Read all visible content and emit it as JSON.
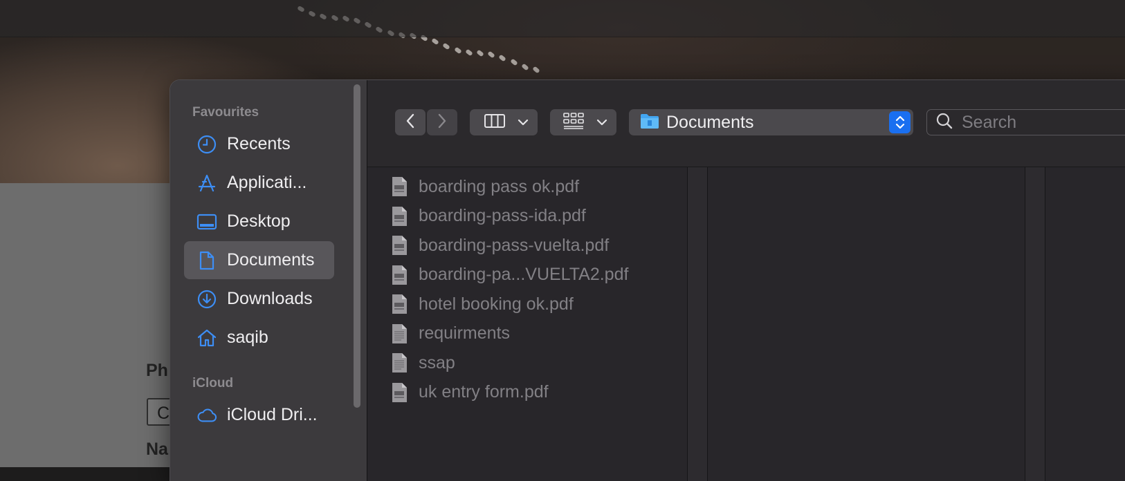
{
  "background": {
    "field_labels": [
      "Ph",
      "Na"
    ],
    "field_value": "C"
  },
  "sidebar": {
    "sections": [
      {
        "title": "Favourites",
        "items": [
          {
            "label": "Recents",
            "icon": "clock-icon",
            "selected": false
          },
          {
            "label": "Applicati...",
            "icon": "applications-icon",
            "selected": false
          },
          {
            "label": "Desktop",
            "icon": "desktop-icon",
            "selected": false
          },
          {
            "label": "Documents",
            "icon": "document-icon",
            "selected": true
          },
          {
            "label": "Downloads",
            "icon": "download-icon",
            "selected": false
          },
          {
            "label": "saqib",
            "icon": "home-icon",
            "selected": false
          }
        ]
      },
      {
        "title": "iCloud",
        "items": [
          {
            "label": "iCloud Dri...",
            "icon": "cloud-icon",
            "selected": false
          }
        ]
      }
    ]
  },
  "toolbar": {
    "location": "Documents",
    "search_placeholder": "Search"
  },
  "files": [
    {
      "name": "boarding pass ok.pdf",
      "type": "pdf"
    },
    {
      "name": "boarding-pass-ida.pdf",
      "type": "pdf"
    },
    {
      "name": "boarding-pass-vuelta.pdf",
      "type": "pdf"
    },
    {
      "name": "boarding-pa...VUELTA2.pdf",
      "type": "pdf"
    },
    {
      "name": "hotel booking ok.pdf",
      "type": "pdf"
    },
    {
      "name": "requirments",
      "type": "text"
    },
    {
      "name": "ssap",
      "type": "text"
    },
    {
      "name": "uk entry form.pdf",
      "type": "pdf"
    }
  ],
  "colors": {
    "accent": "#1a6ff0",
    "sidebar_icon": "#3d8ef5",
    "selected_row": "#58565a"
  }
}
